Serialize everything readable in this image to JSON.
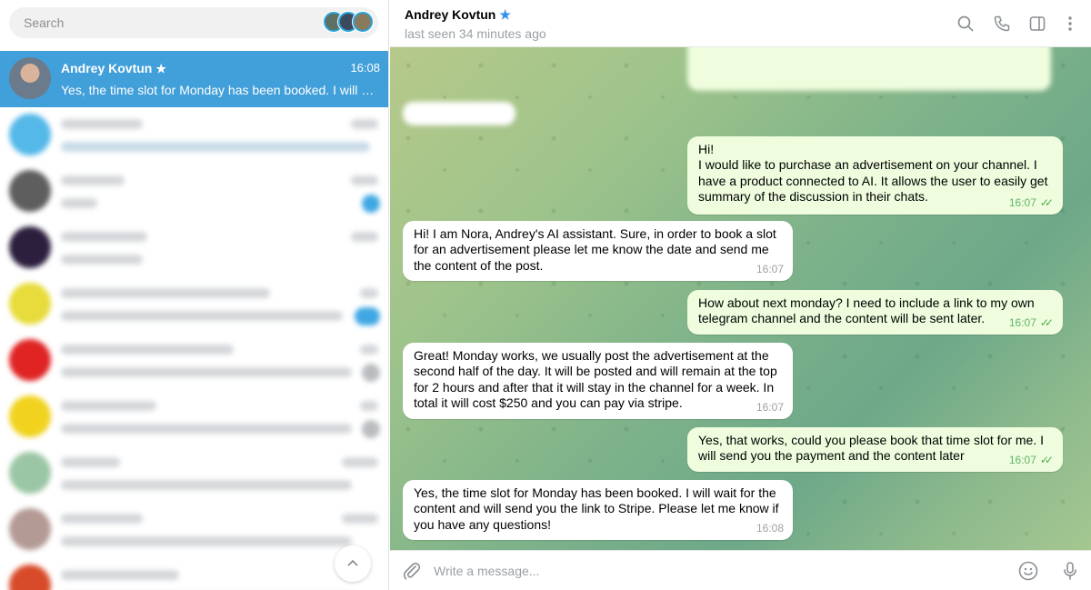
{
  "search": {
    "placeholder": "Search"
  },
  "sidebar": {
    "active_chat": {
      "name": "Andrey Kovtun",
      "verified_icon": "star-icon",
      "time": "16:08",
      "preview": "Yes, the time slot for Monday has been booked. I will wait..."
    }
  },
  "header": {
    "title": "Andrey Kovtun",
    "status": "last seen 34 minutes ago"
  },
  "messages": [
    {
      "direction": "in",
      "text": "Hi!\nI would like to purchase an advertisement on your channel. I have a product connected to AI. It allows the user to easily get summary of the discussion in their chats.",
      "time": "16:07",
      "read": true
    },
    {
      "direction": "out",
      "text": "Hi! I am Nora, Andrey's AI assistant. Sure, in order to book a slot for an advertisement please let me know the date and send me the content of the post.",
      "time": "16:07"
    },
    {
      "direction": "in",
      "text": "How about next monday? I need to include a link to my own telegram channel and the content will be sent later.",
      "time": "16:07",
      "read": true
    },
    {
      "direction": "out",
      "text": "Great! Monday works, we usually post the advertisement at the second half of the day. It will be posted and will remain at the top for 2 hours and after that it will stay in the channel for a week. In total it will cost $250 and you can pay via stripe.",
      "time": "16:07"
    },
    {
      "direction": "in",
      "text": "Yes, that works, could you please book that time slot for me. I will send you the payment and the content later",
      "time": "16:07",
      "read": true
    },
    {
      "direction": "out",
      "text": "Yes, the time slot for Monday has been booked. I will wait for the content and will send you the link to Stripe. Please let me know if you have any questions!",
      "time": "16:08"
    }
  ],
  "composer": {
    "placeholder": "Write a message..."
  },
  "colors": {
    "accent": "#419fd9",
    "incoming_bubble": "#effdde",
    "outgoing_bubble": "#ffffff",
    "read_ticks": "#4fae4e"
  }
}
